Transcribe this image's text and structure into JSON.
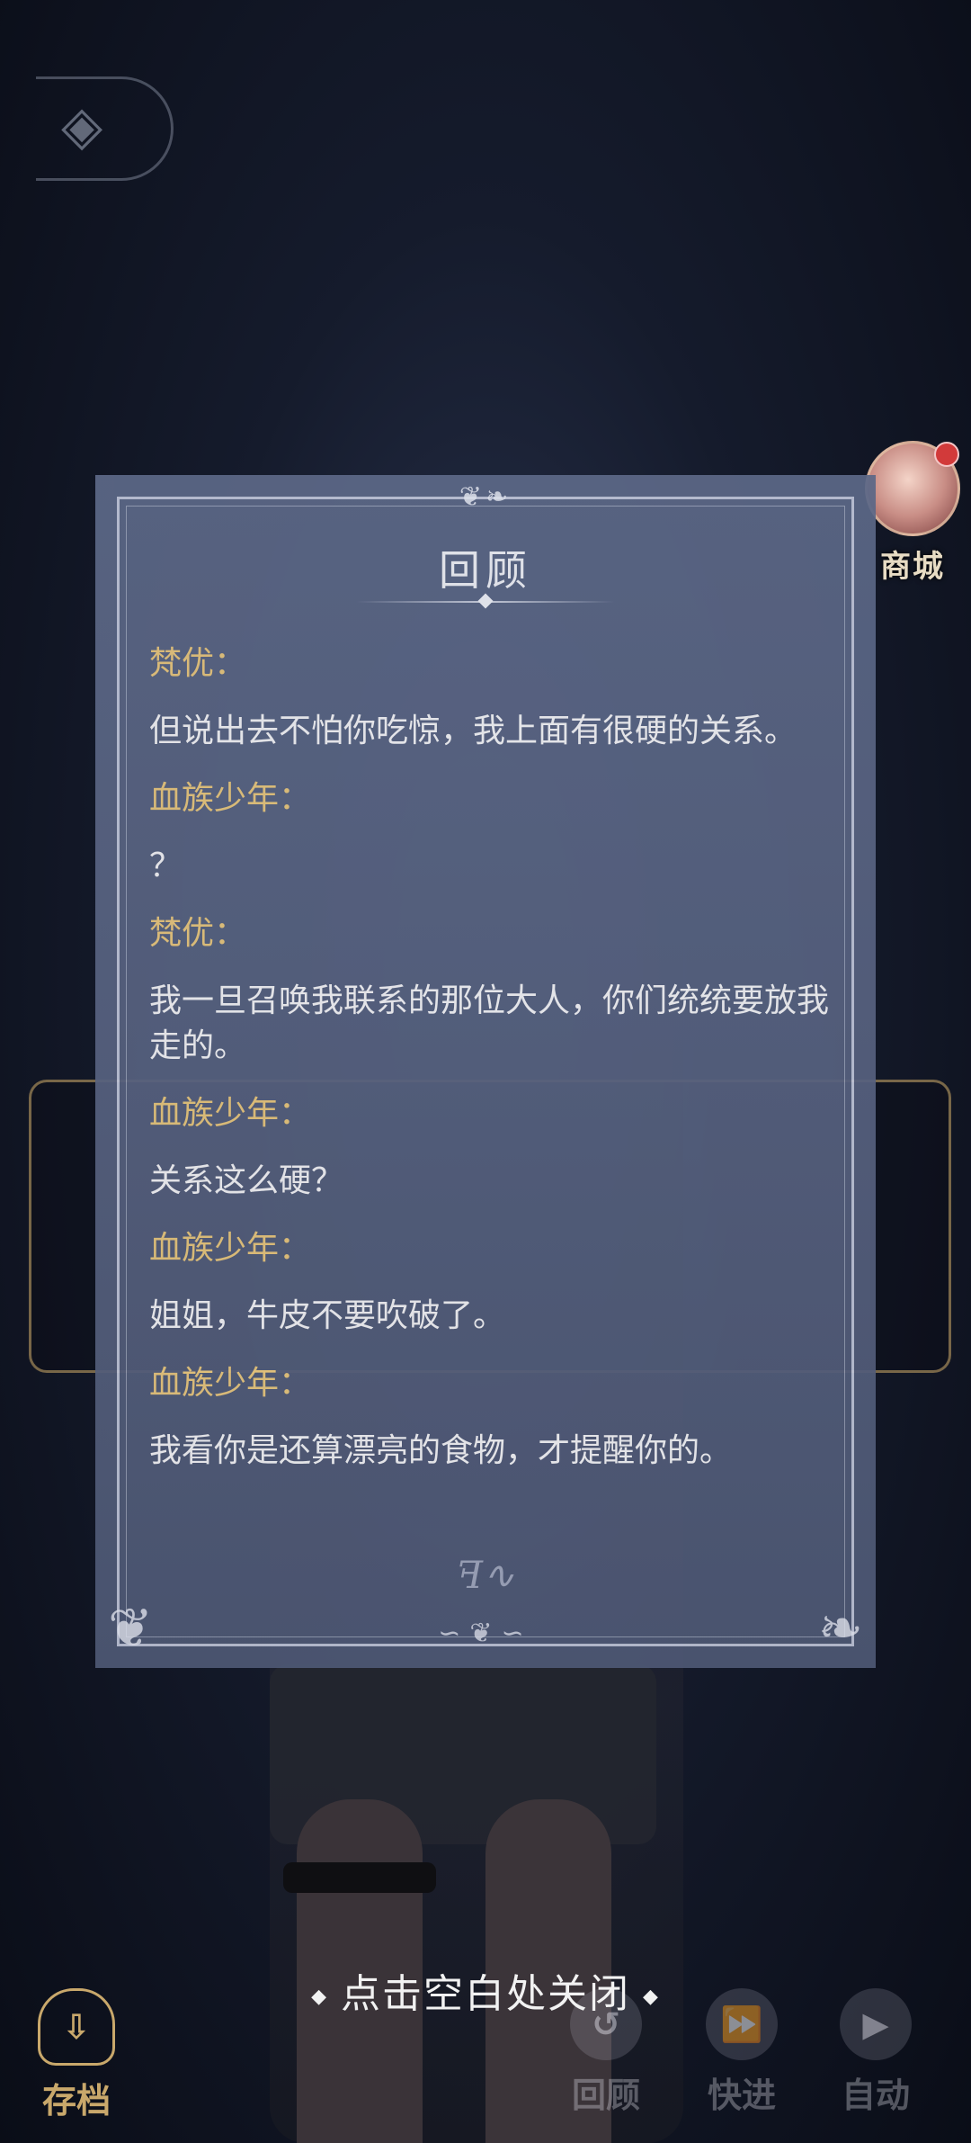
{
  "shop": {
    "label": "商城"
  },
  "review": {
    "title": "回顾",
    "entries": [
      {
        "speaker": "梵优：",
        "text": "但说出去不怕你吃惊，我上面有很硬的关系。"
      },
      {
        "speaker": "血族少年：",
        "text": "？"
      },
      {
        "speaker": "梵优：",
        "text": "我一旦召唤我联系的那位大人，你们统统要放我走的。"
      },
      {
        "speaker": "血族少年：",
        "text": "关系这么硬？"
      },
      {
        "speaker": "血族少年：",
        "text": "姐姐，牛皮不要吹破了。"
      },
      {
        "speaker": "血族少年：",
        "text": "我看你是还算漂亮的食物，才提醒你的。"
      }
    ]
  },
  "close_hint": "点击空白处关闭",
  "bottom_bar": {
    "save": "存档",
    "review": "回顾",
    "fast_forward": "快进",
    "auto": "自动"
  },
  "icons": {
    "back": "back-arrow-icon",
    "save": "cloud-download-icon",
    "review": "history-icon",
    "fast_forward": "fast-forward-icon",
    "auto": "play-icon"
  },
  "colors": {
    "panel": "#5c6887",
    "speaker": "#e7c67e",
    "text": "#f2f2f5",
    "accent_gold": "#c9a86b"
  }
}
